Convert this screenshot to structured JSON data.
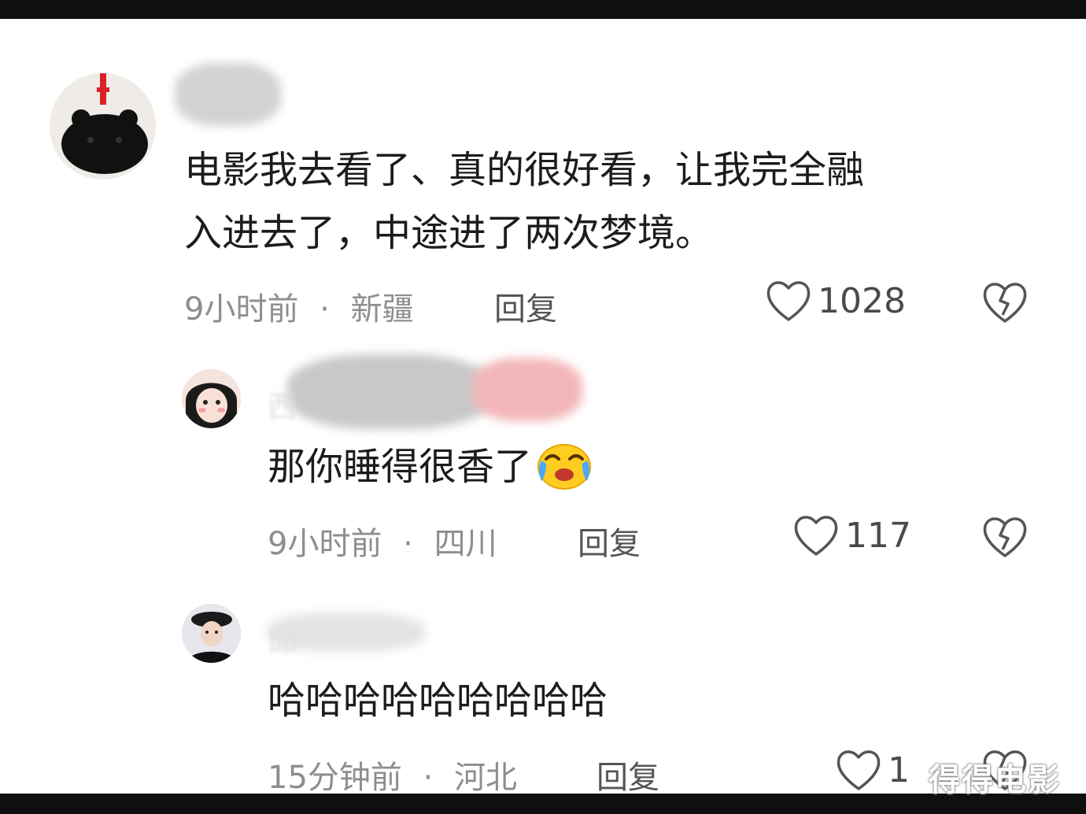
{
  "comments": [
    {
      "name": "",
      "text_line1": "电影我去看了、真的很好看，让我完全融",
      "text_line2": "入进去了，中途进了两次梦境。",
      "time": "9小时前",
      "location": "新疆",
      "reply_label": "回复",
      "likes": "1028"
    },
    {
      "name": "西",
      "text": "那你睡得很香了",
      "emoji": "crying-laughing-emoji",
      "time": "9小时前",
      "location": "四川",
      "reply_label": "回复",
      "likes": "117"
    },
    {
      "name": "邱",
      "text": "哈哈哈哈哈哈哈哈哈",
      "time": "15分钟前",
      "location": "河北",
      "reply_label": "回复",
      "likes": "1"
    }
  ],
  "watermark": "得得电影",
  "separator": "·",
  "colors": {
    "meta": "#8e8e8e",
    "text": "#1c1c1c",
    "icon": "#555555"
  }
}
